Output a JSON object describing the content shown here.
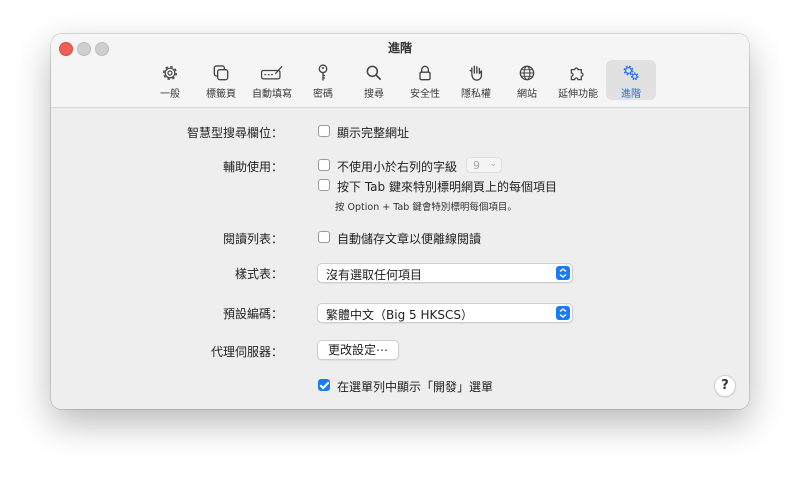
{
  "window": {
    "title": "進階"
  },
  "tabs": [
    {
      "label": "一般",
      "icon": "gear-icon"
    },
    {
      "label": "標籤頁",
      "icon": "tabs-icon"
    },
    {
      "label": "自動填寫",
      "icon": "autofill-icon"
    },
    {
      "label": "密碼",
      "icon": "key-icon"
    },
    {
      "label": "搜尋",
      "icon": "magnifier-icon"
    },
    {
      "label": "安全性",
      "icon": "lock-icon"
    },
    {
      "label": "隱私權",
      "icon": "hand-icon"
    },
    {
      "label": "網站",
      "icon": "globe-icon"
    },
    {
      "label": "延伸功能",
      "icon": "puzzle-icon"
    },
    {
      "label": "進階",
      "icon": "gears-icon",
      "active": true
    }
  ],
  "settings": {
    "smart_search": {
      "label": "智慧型搜尋欄位：",
      "option": "顯示完整網址",
      "checked": false
    },
    "accessibility": {
      "label": "輔助使用：",
      "min_font_option": "不使用小於右列的字級",
      "min_font_value": "9",
      "min_font_checked": false,
      "tab_option": "按下 Tab 鍵來特別標明網頁上的每個項目",
      "tab_checked": false,
      "tab_hint": "按 Option + Tab 鍵會特別標明每個項目。"
    },
    "reading_list": {
      "label": "閱讀列表：",
      "option": "自動儲存文章以便離線閱讀",
      "checked": false
    },
    "style_sheet": {
      "label": "樣式表：",
      "value": "沒有選取任何項目"
    },
    "default_encoding": {
      "label": "預設編碼：",
      "value": "繁體中文（Big 5 HKSCS）"
    },
    "proxies": {
      "label": "代理伺服器：",
      "button": "更改設定⋯"
    },
    "develop_menu": {
      "option": "在選單列中顯示「開發」選單",
      "checked": true
    }
  },
  "help": {
    "label": "?"
  },
  "colors": {
    "accent": "#1a7cf3",
    "close": "#ee5f57"
  }
}
